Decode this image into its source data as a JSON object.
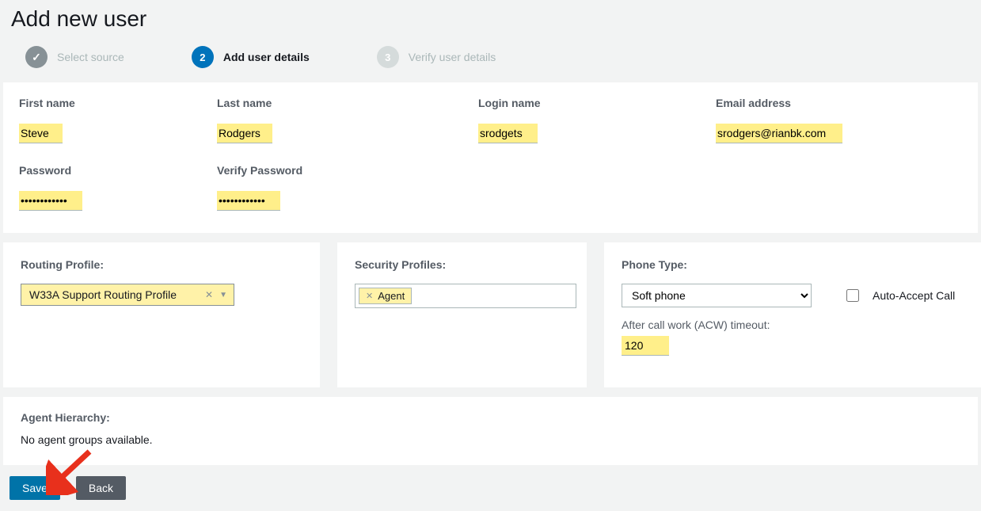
{
  "page": {
    "title": "Add new user"
  },
  "steps": {
    "s1": {
      "label": "Select source"
    },
    "s2": {
      "num": "2",
      "label": "Add user details"
    },
    "s3": {
      "num": "3",
      "label": "Verify user details"
    }
  },
  "fields": {
    "first_name": {
      "label": "First name",
      "value": "Steve"
    },
    "last_name": {
      "label": "Last name",
      "value": "Rodgers"
    },
    "login_name": {
      "label": "Login name",
      "value": "srodgets"
    },
    "email": {
      "label": "Email address",
      "value": "srodgers@rianbk.com"
    },
    "password": {
      "label": "Password",
      "value": "••••••••••••"
    },
    "verify_pw": {
      "label": "Verify Password",
      "value": "••••••••••••"
    }
  },
  "routing": {
    "label": "Routing Profile:",
    "value": "W33A Support Routing Profile"
  },
  "security": {
    "label": "Security Profiles:",
    "tags": [
      "Agent"
    ]
  },
  "phone": {
    "label": "Phone Type:",
    "selected": "Soft phone",
    "auto_accept_label": "Auto-Accept Call",
    "acw_label": "After call work (ACW) timeout:",
    "acw_value": "120"
  },
  "hierarchy": {
    "label": "Agent Hierarchy:",
    "message": "No agent groups available."
  },
  "buttons": {
    "save": "Save",
    "back": "Back"
  }
}
